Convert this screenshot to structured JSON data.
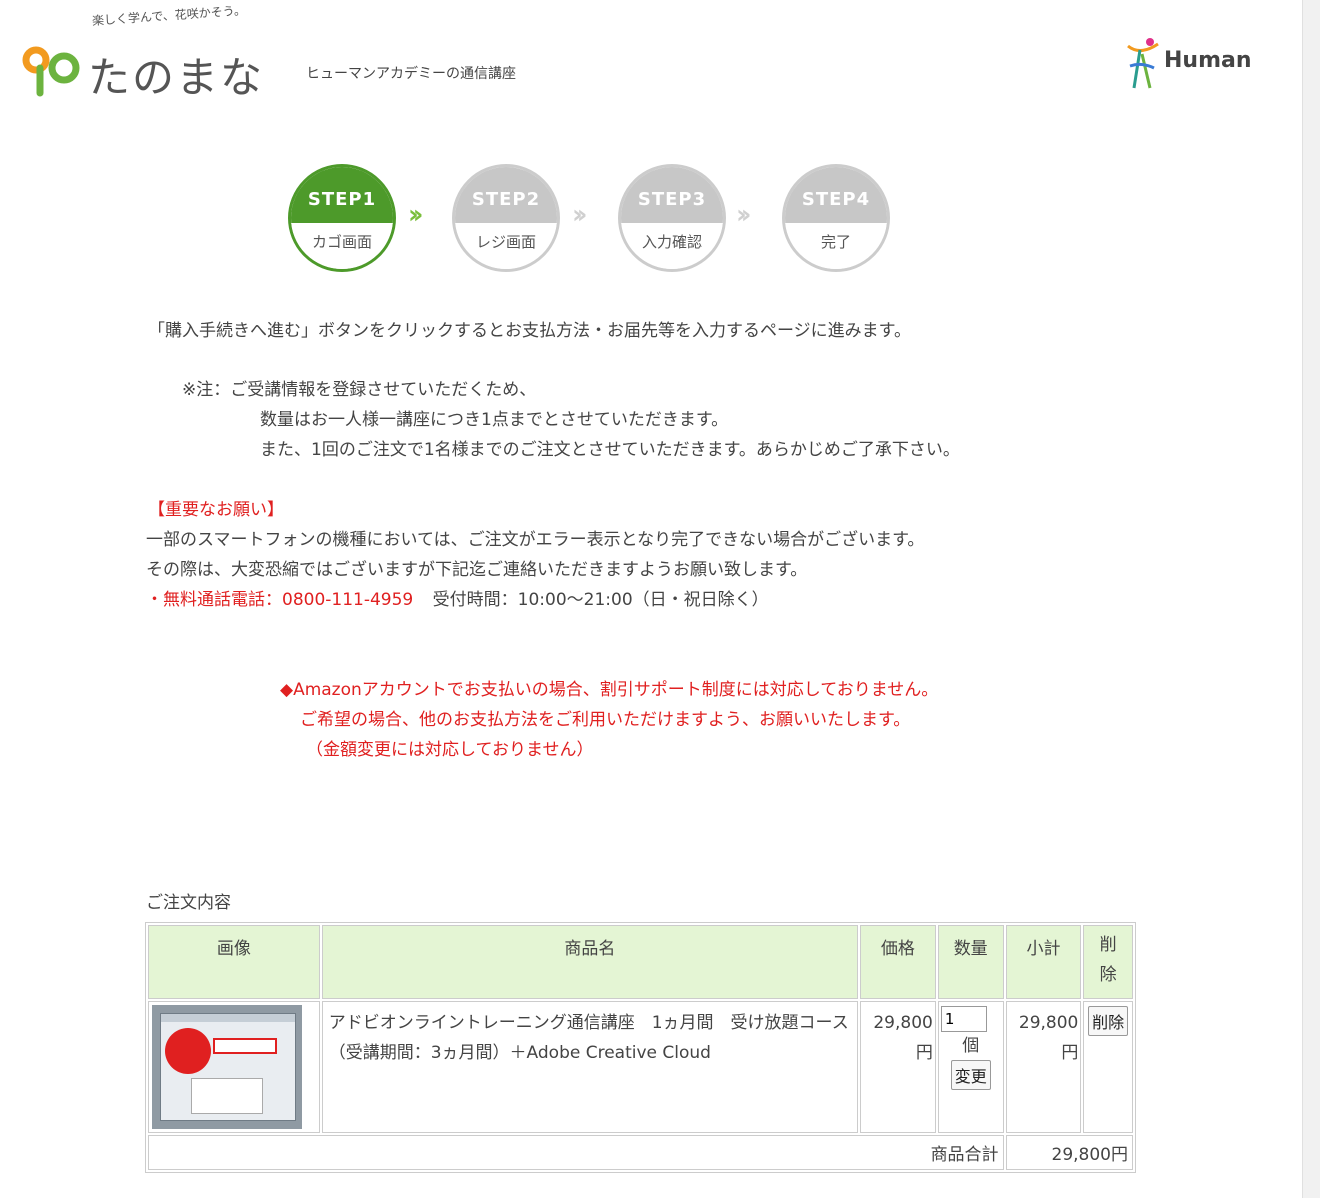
{
  "header": {
    "tagline": "楽しく学んで、花咲かそう。",
    "logo_text": "たのまな",
    "subtitle": "ヒューマンアカデミーの通信講座",
    "human_logo": "Human"
  },
  "steps": [
    {
      "label": "STEP1",
      "name": "カゴ画面",
      "active": true
    },
    {
      "label": "STEP2",
      "name": "レジ画面",
      "active": false
    },
    {
      "label": "STEP3",
      "name": "入力確認",
      "active": false
    },
    {
      "label": "STEP4",
      "name": "完了",
      "active": false
    }
  ],
  "intro": "「購入手続きへ進む」ボタンをクリックするとお支払方法・お届先等を入力するページに進みます。",
  "note": {
    "line1": "※注：ご受講情報を登録させていただくため、",
    "line2": "数量はお一人様一講座につき1点までとさせていただきます。",
    "line3": "また、1回のご注文で1名様までのご注文とさせていただきます。あらかじめご了承下さい。"
  },
  "important": {
    "heading": "【重要なお願い】",
    "line1": "一部のスマートフォンの機種においては、ご注文がエラー表示となり完了できない場合がございます。",
    "line2": "その際は、大変恐縮ではございますが下記迄ご連絡いただきますようお願い致します。",
    "phone": "・無料通話電話：0800-111-4959",
    "hours": "受付時間：10:00〜21:00（日・祝日除く）"
  },
  "amazon_notice": {
    "line1": "◆Amazonアカウントでお支払いの場合、割引サポート制度には対応しておりません。",
    "line2": "ご希望の場合、他のお支払方法をご利用いただけますよう、お願いいたします。",
    "line3": "（金額変更には対応しておりません）"
  },
  "order": {
    "label": "ご注文内容",
    "headers": {
      "image": "画像",
      "product": "商品名",
      "price": "価格",
      "qty": "数量",
      "subtotal": "小計",
      "delete": "削除"
    },
    "item": {
      "name": "アドビオンライントレーニング通信講座　1ヵ月間　受け放題コース（受講期間：3ヵ月間）＋Adobe Creative Cloud",
      "price": "29,800",
      "price_unit": "円",
      "qty": "1",
      "qty_unit": "個",
      "change_button": "変更",
      "subtotal": "29,800",
      "subtotal_unit": "円",
      "delete_button": "削除"
    },
    "total_label": "商品合計",
    "total_value": "29,800円"
  }
}
